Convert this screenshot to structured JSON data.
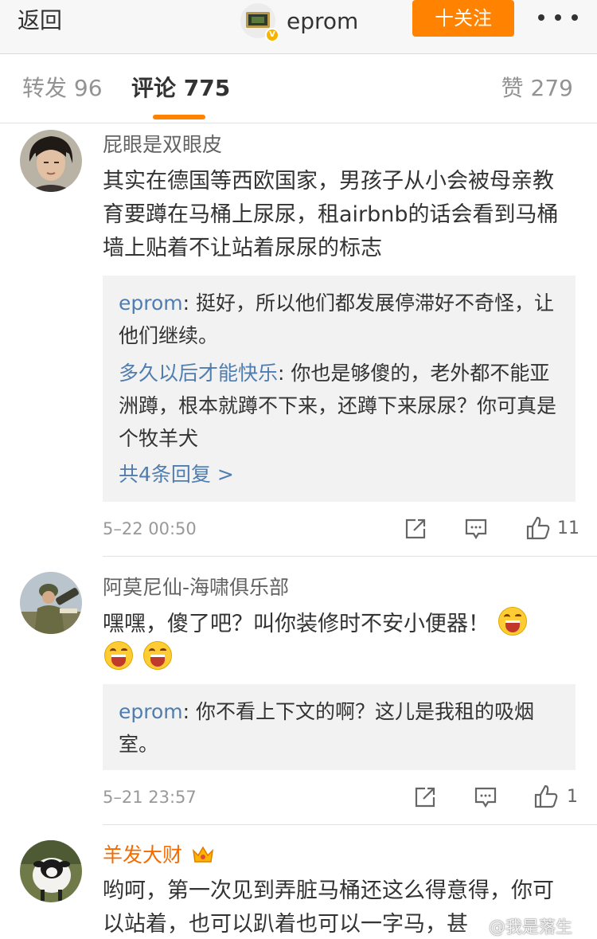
{
  "nav": {
    "back_label": "返回",
    "username": "eprom",
    "follow_label": "十关注",
    "avatar_badge": "V",
    "more_icon": "more-dots-icon"
  },
  "tabs": {
    "repost": "转发 96",
    "comment": "评论 775",
    "like": "赞 279",
    "accent_color": "#ff8200"
  },
  "comments": [
    {
      "name": "屁眼是双眼皮",
      "text": "其实在德国等西欧国家，男孩子从小会被母亲教育要蹲在马桶上尿尿，租airbnb的话会看到马桶墙上贴着不让站着尿尿的标志",
      "replies": [
        {
          "author": "eprom",
          "text": ": 挺好，所以他们都发展停滞好不奇怪，让他们继续。"
        },
        {
          "author": "多久以后才能快乐",
          "text": ": 你也是够傻的，老外都不能亚洲蹲，根本就蹲不下来，还蹲下来尿尿？你可真是个牧羊犬"
        }
      ],
      "more_replies": "共4条回复 >",
      "time": "5–22 00:50",
      "likes": "11"
    },
    {
      "name": "阿莫尼仙-海啸俱乐部",
      "text": "嘿嘿，傻了吧？叫你装修时不安小便器！",
      "emoji_count": 3,
      "replies": [
        {
          "author": "eprom",
          "text": ": 你不看上下文的啊？这儿是我租的吸烟室。"
        }
      ],
      "time": "5–21 23:57",
      "likes": "1"
    },
    {
      "name": "羊发大财",
      "name_color": "#f56b00",
      "text": "哟呵，第一次见到弄脏马桶还这么得意得，你可以站着，也可以趴着也可以一字马，甚"
    }
  ],
  "watermark": "@我是落生"
}
